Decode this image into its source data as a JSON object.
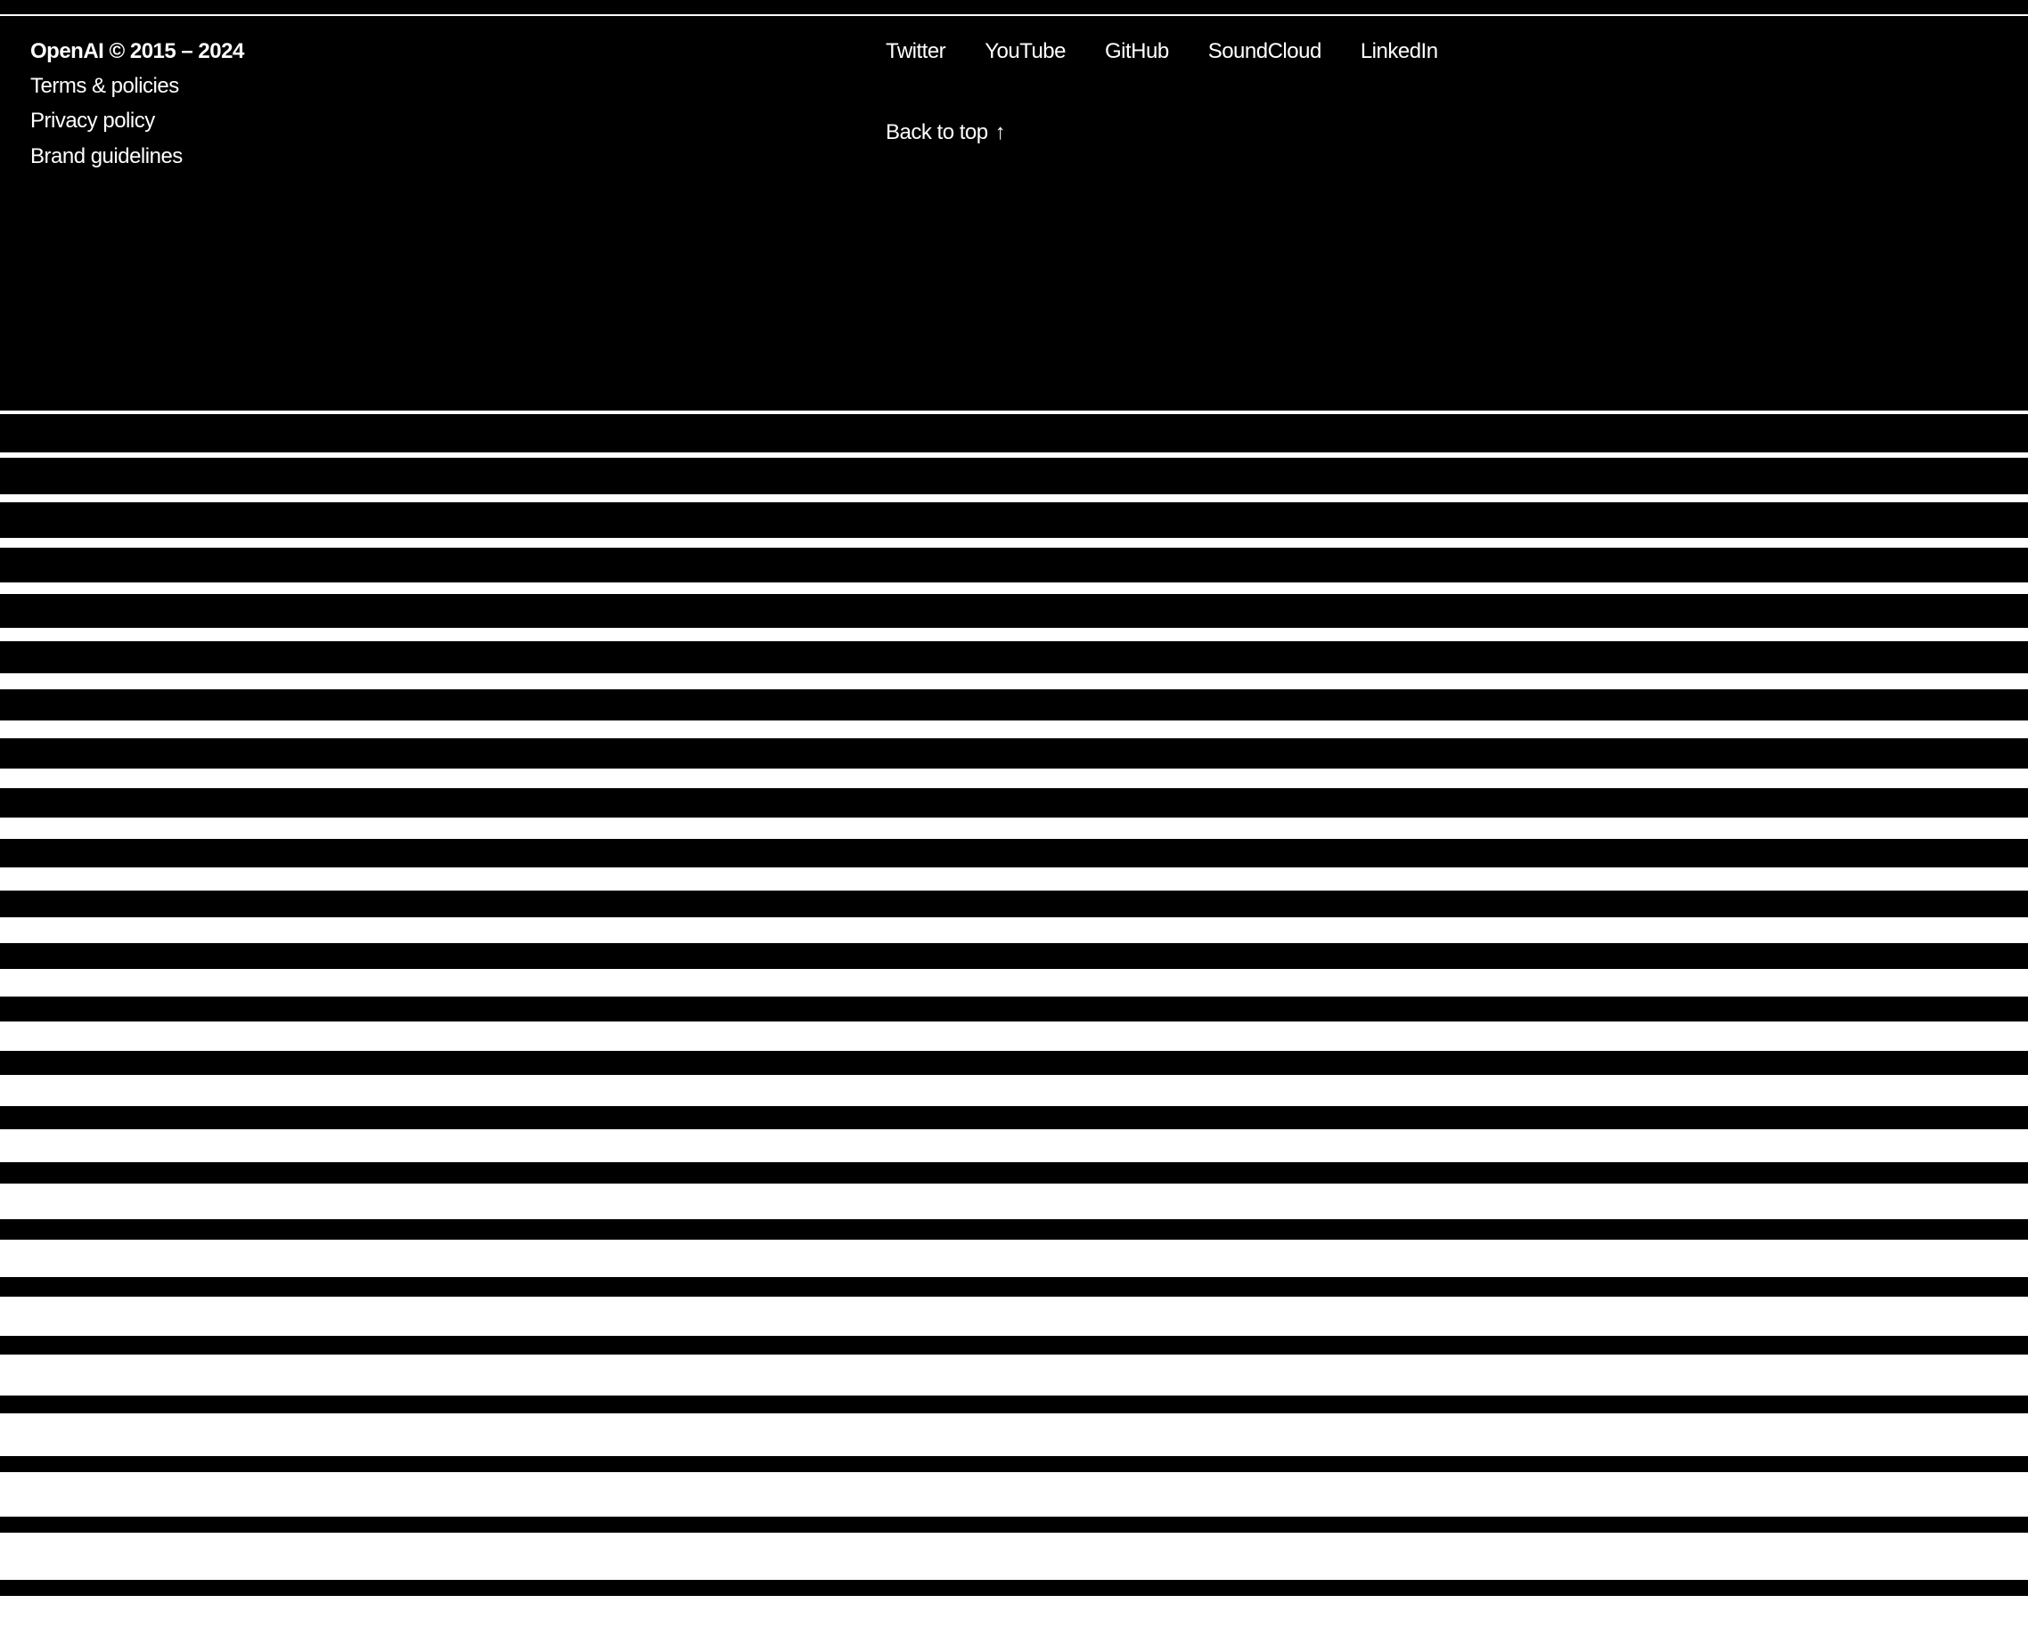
{
  "footer": {
    "copyright": "OpenAI © 2015 – 2024",
    "links": [
      "Terms & policies",
      "Privacy policy",
      "Brand guidelines"
    ],
    "social": [
      "Twitter",
      "YouTube",
      "GitHub",
      "SoundCloud",
      "LinkedIn"
    ],
    "back_to_top": "Back to top",
    "back_to_top_arrow": "↑"
  },
  "decoration": {
    "stripe_count": 24,
    "colors": {
      "bg": "#000000",
      "fg": "#ffffff"
    }
  }
}
